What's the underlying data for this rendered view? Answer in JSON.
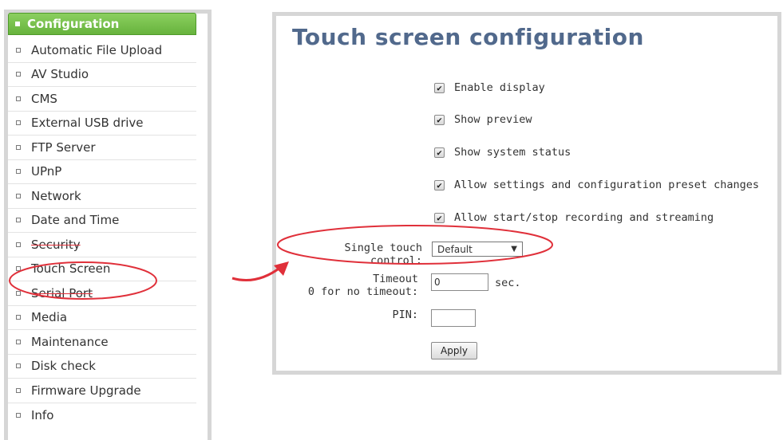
{
  "sidebar": {
    "header": "Configuration",
    "items": [
      {
        "label": "Automatic File Upload"
      },
      {
        "label": "AV Studio"
      },
      {
        "label": "CMS"
      },
      {
        "label": "External USB drive"
      },
      {
        "label": "FTP Server"
      },
      {
        "label": "UPnP"
      },
      {
        "label": "Network"
      },
      {
        "label": "Date and Time"
      },
      {
        "label": "Security"
      },
      {
        "label": "Touch Screen"
      },
      {
        "label": "Serial Port"
      },
      {
        "label": "Media"
      },
      {
        "label": "Maintenance"
      },
      {
        "label": "Disk check"
      },
      {
        "label": "Firmware Upgrade"
      },
      {
        "label": "Info"
      }
    ]
  },
  "main": {
    "title": "Touch screen configuration",
    "checkboxes": [
      {
        "label": "Enable display",
        "checked": true
      },
      {
        "label": "Show preview",
        "checked": true
      },
      {
        "label": "Show system status",
        "checked": true
      },
      {
        "label": "Allow settings and configuration preset changes",
        "checked": true
      },
      {
        "label": "Allow start/stop recording and streaming",
        "checked": true
      }
    ],
    "single_touch": {
      "label": "Single touch control:",
      "value": "Default"
    },
    "timeout": {
      "label_line1": "Timeout",
      "label_line2": "0 for no timeout:",
      "value": "0",
      "unit": "sec."
    },
    "pin": {
      "label": "PIN:",
      "value": ""
    },
    "apply_label": "Apply"
  },
  "colors": {
    "accent_green": "#67b33d",
    "title_blue": "#51698c",
    "annotation_red": "#e0303a"
  }
}
